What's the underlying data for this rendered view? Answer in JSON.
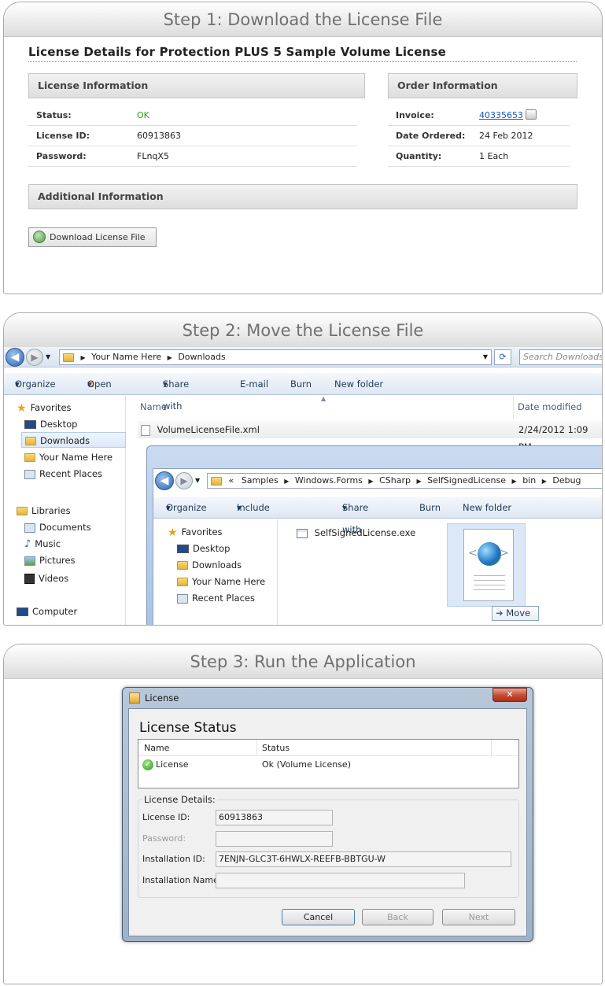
{
  "step1": {
    "header": "Step 1: Download the License File",
    "title": "License Details for Protection PLUS 5 Sample Volume License",
    "license_info_header": "License Information",
    "order_info_header": "Order Information",
    "additional_info_header": "Additional Information",
    "license_rows": [
      {
        "label": "Status:",
        "value": "OK"
      },
      {
        "label": "License ID:",
        "value": "60913863"
      },
      {
        "label": "Password:",
        "value": "FLnqX5"
      }
    ],
    "order_rows": [
      {
        "label": "Invoice:",
        "value": "40335653"
      },
      {
        "label": "Date Ordered:",
        "value": "24 Feb 2012"
      },
      {
        "label": "Quantity:",
        "value": "1 Each"
      }
    ],
    "status_color": "#2a9d2a",
    "download_button": "Download License File"
  },
  "step2": {
    "header": "Step 2: Move the License File",
    "outer": {
      "breadcrumb": [
        "Your Name Here",
        "Downloads"
      ],
      "search_placeholder": "Search Downloads",
      "toolbar": [
        "Organize",
        "Open",
        "Share with",
        "E-mail",
        "Burn",
        "New folder"
      ],
      "nav": {
        "favorites": "Favorites",
        "fav_items": [
          "Desktop",
          "Downloads",
          "Your Name Here",
          "Recent Places"
        ],
        "libraries": "Libraries",
        "lib_items": [
          "Documents",
          "Music",
          "Pictures",
          "Videos"
        ],
        "computer": "Computer"
      },
      "columns": {
        "name": "Name",
        "date": "Date modified"
      },
      "file": {
        "name": "VolumeLicenseFile.xml",
        "date": "2/24/2012 1:09 PM"
      }
    },
    "inner": {
      "breadcrumb_prefix": "«",
      "breadcrumb": [
        "Samples",
        "Windows.Forms",
        "CSharp",
        "SelfSignedLicense",
        "bin",
        "Debug"
      ],
      "toolbar": [
        "Organize",
        "Include in library",
        "Share with",
        "Burn",
        "New folder"
      ],
      "nav": {
        "favorites": "Favorites",
        "fav_items": [
          "Desktop",
          "Downloads",
          "Your Name Here",
          "Recent Places"
        ]
      },
      "file": "SelfSignedLicense.exe",
      "move_label": "Move"
    }
  },
  "step3": {
    "header": "Step 3: Run the Application",
    "window_title": "License",
    "close_glyph": "✕",
    "heading": "License Status",
    "table_headers": {
      "name": "Name",
      "status": "Status"
    },
    "table_row": {
      "name": "License",
      "status": "Ok (Volume License)"
    },
    "details_label": "License Details:",
    "fields": {
      "license_id_label": "License ID:",
      "license_id": "60913863",
      "password_label": "Password:",
      "password": "",
      "installation_id_label": "Installation ID:",
      "installation_id": "7ENJN-GLC3T-6HWLX-REEFB-BBTGU-W",
      "installation_name_label": "Installation Name:",
      "installation_name": ""
    },
    "buttons": {
      "cancel": "Cancel",
      "back": "Back",
      "next": "Next"
    }
  }
}
